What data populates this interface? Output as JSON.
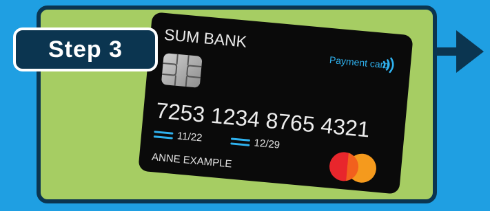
{
  "step": {
    "label": "Step 3"
  },
  "card": {
    "bank_name": "SUM BANK",
    "type_label": "Payment card",
    "number": "7253 1234 8765 4321",
    "valid_from": "11/22",
    "expires": "12/29",
    "holder_name": "ANNE EXAMPLE",
    "contactless_icon": "contactless-icon",
    "network_logo": "mastercard-logo"
  },
  "colors": {
    "background": "#1f9fe2",
    "panel": "#a6cd63",
    "dark_navy": "#0b3550",
    "card": "#0a0a0a",
    "accent_blue": "#2fb2ef",
    "mc_red": "#e8262c",
    "mc_orange": "#f59a1d"
  }
}
